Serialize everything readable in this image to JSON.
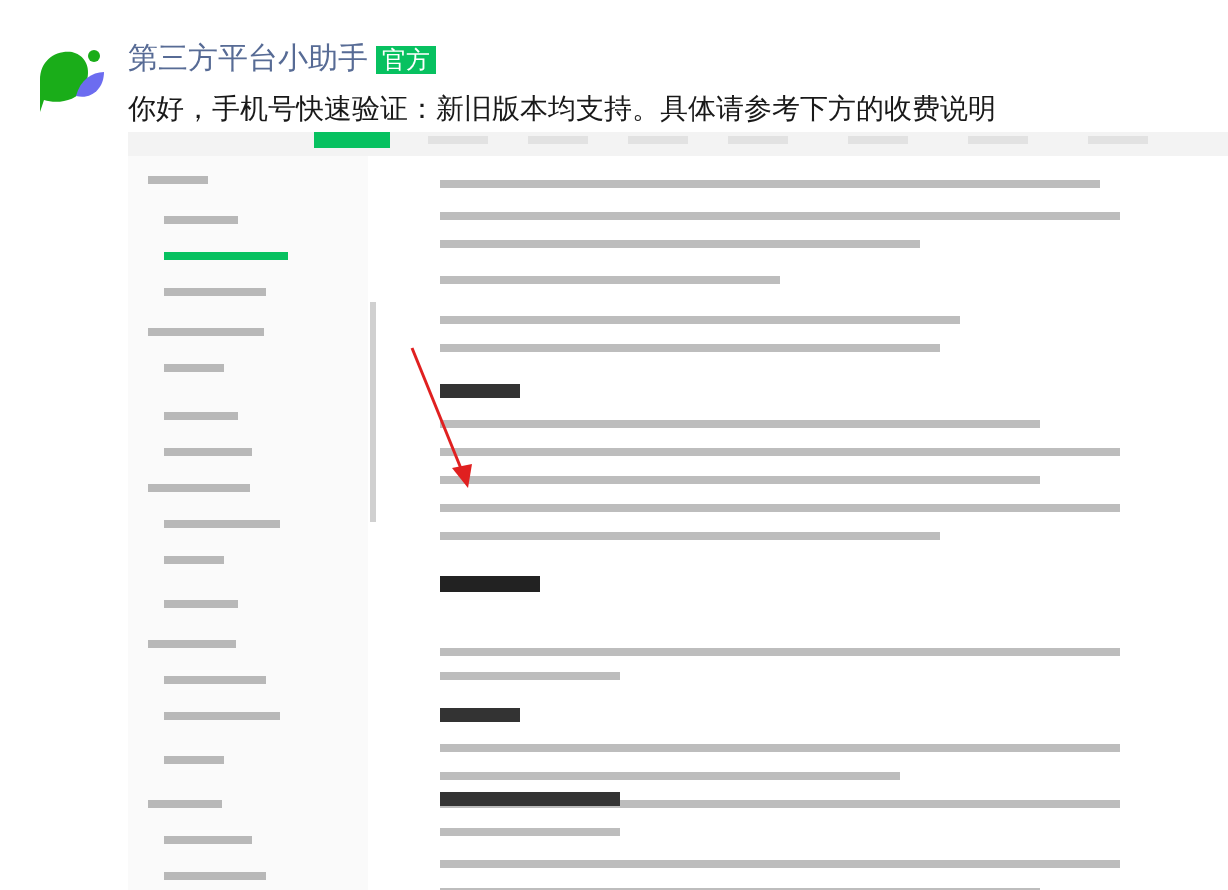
{
  "message": {
    "sender": "第三方平台小助手",
    "badge": "官方",
    "text": "你好，手机号快速验证：新旧版本均支持。具体请参考下方的收费说明"
  }
}
